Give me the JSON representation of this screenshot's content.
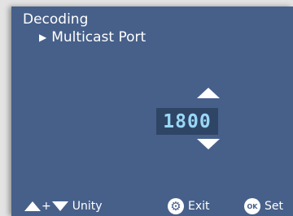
{
  "screen": {
    "title": "Decoding",
    "subtitle": "Multicast Port",
    "value": "1800"
  },
  "footer": {
    "plus": "+",
    "unity_label": "Unity",
    "exit_label": "Exit",
    "set_label": "Set",
    "ok_text": "OK"
  },
  "icons": {
    "subtitle_marker": "play-triangle-icon",
    "increment": "arrow-up-icon",
    "decrement": "arrow-down-icon",
    "exit": "gear-icon",
    "set": "ok-icon"
  },
  "colors": {
    "screen_background": "#47608a",
    "value_box_background": "#2f4565",
    "value_text": "#9ad7f7",
    "text": "#ffffff",
    "frame_background": "#e3e3e3"
  }
}
